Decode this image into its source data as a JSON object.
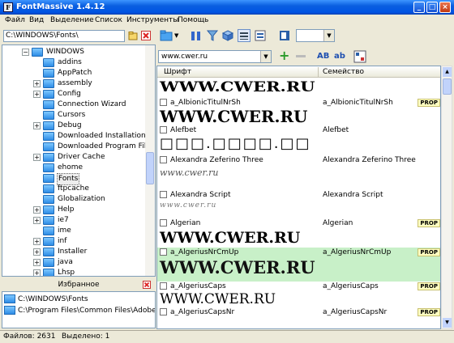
{
  "window": {
    "title": "FontMassive 1.4.12",
    "app_icon_letter": "F",
    "min": "_",
    "max": "□",
    "close": "×"
  },
  "menu": [
    "Файл",
    "Вид",
    "Выделение",
    "Список",
    "Инструменты",
    "Помощь"
  ],
  "path": {
    "value": "C:\\WINDOWS\\Fonts\\"
  },
  "tree": {
    "root": "WINDOWS",
    "items": [
      "addins",
      "AppPatch",
      "assembly",
      "Config",
      "Connection Wizard",
      "Cursors",
      "Debug",
      "Downloaded Installations",
      "Downloaded Program Files",
      "Driver Cache",
      "ehome",
      "Fonts",
      "ftpcache",
      "Globalization",
      "Help",
      "ie7",
      "ime",
      "inf",
      "Installer",
      "java",
      "Lhsp"
    ],
    "selected": "Fonts"
  },
  "favorites": {
    "title": "Избранное",
    "items": [
      "C:\\WINDOWS\\Fonts",
      "C:\\Program Files\\Common Files\\Adobe\\Fonts"
    ]
  },
  "filter": {
    "value": "www.cwer.ru"
  },
  "toolbar": {
    "ab_bold": "AB",
    "ab_small": "ab",
    "plus": "+"
  },
  "list": {
    "col_font": "Шрифт",
    "col_family": "Семейство",
    "preview_text": "WWW.CWER.RU",
    "prop_label": "PROP",
    "rows": [
      {
        "name": "a_AlbionicTitulNrSh",
        "family": "a_AlbionicTitulNrSh",
        "preview": "WWW.CWER.RU"
      },
      {
        "name": "Alefbet",
        "family": "Alefbet",
        "preview": "□□□.□□□□.□□"
      },
      {
        "name": "Alexandra Zeferino Three",
        "family": "Alexandra Zeferino Three",
        "preview": "www.cwer.ru"
      },
      {
        "name": "Alexandra Script",
        "family": "Alexandra Script",
        "preview": "www.cwer.ru"
      },
      {
        "name": "Algerian",
        "family": "Algerian",
        "preview": "WWW.CWER.RU"
      },
      {
        "name": "a_AlgeriusNrCmUp",
        "family": "a_AlgeriusNrCmUp",
        "preview": "WWW.CWER.RU"
      },
      {
        "name": "a_AlgeriusCaps",
        "family": "a_AlgeriusCaps",
        "preview": "WWW.CWER.RU"
      },
      {
        "name": "a_AlgeriusCapsNr",
        "family": "a_AlgeriusCapsNr",
        "preview": ""
      }
    ],
    "top_preview": "WWW.CWER.RU"
  },
  "status": {
    "files": "Файлов: 2631",
    "selected": "Выделено: 1"
  },
  "colors": {
    "highlight": "#c8f0c8",
    "prop_bg": "#ffffc0"
  }
}
